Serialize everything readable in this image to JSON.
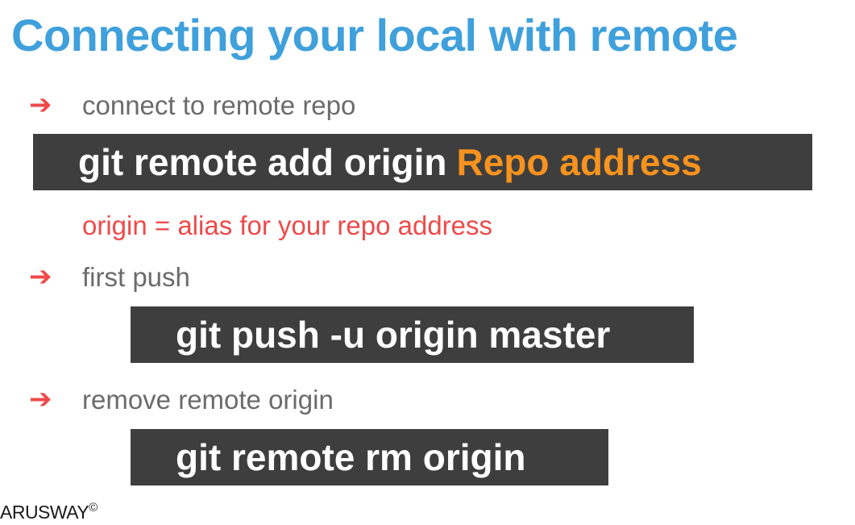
{
  "slide": {
    "title": "Connecting your local with remote",
    "arrow_glyph": "➔",
    "sections": [
      {
        "label": "connect to remote repo",
        "command": "git remote add origin",
        "command_highlight": "Repo address",
        "note": "origin = alias for your repo address"
      },
      {
        "label": "first push",
        "command": "git push -u origin master"
      },
      {
        "label": "remove remote origin",
        "command": "git remote rm origin"
      }
    ],
    "brand": {
      "name": "ARUSWAY",
      "mark": "©"
    }
  },
  "colors": {
    "title": "#3fa0dc",
    "arrow": "#f04848",
    "label": "#6b6b6b",
    "note": "#ef4a4a",
    "command_bg": "#3e3e3e",
    "command_text": "#ffffff",
    "highlight": "#f7931e"
  }
}
